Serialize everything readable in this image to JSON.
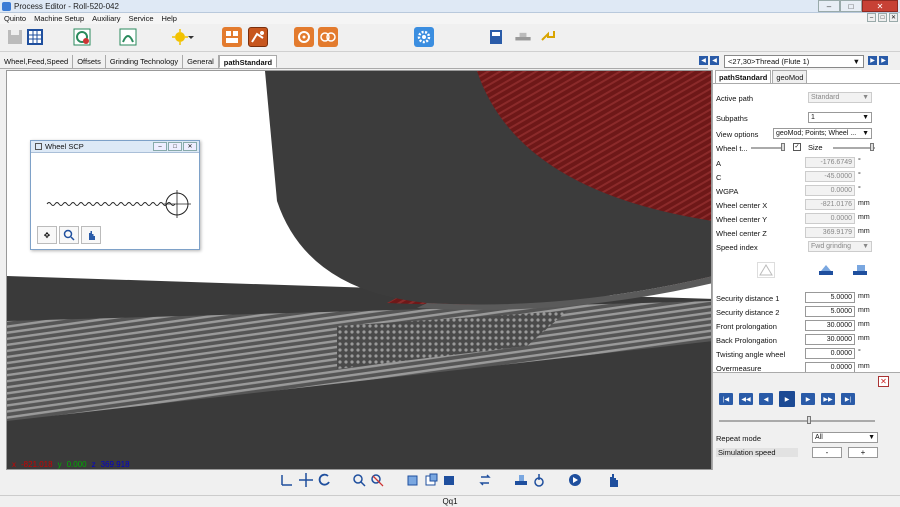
{
  "window": {
    "title": "Process Editor - Roll-520-042"
  },
  "menu": [
    "Quinto",
    "Machine Setup",
    "Auxiliary",
    "Service",
    "Help"
  ],
  "tabs": [
    {
      "label": "Wheel,Feed,Speed",
      "active": false
    },
    {
      "label": "Offsets",
      "active": false
    },
    {
      "label": "Grinding Technology",
      "active": false
    },
    {
      "label": "General",
      "active": false
    },
    {
      "label": "pathStandard",
      "active": true
    }
  ],
  "thread_select": {
    "value": "<27,30>Thread (Flute 1)"
  },
  "scp_window": {
    "title": "Wheel SCP"
  },
  "coords": {
    "x": "-821.018",
    "y": "0.000",
    "z": "369.918"
  },
  "panel": {
    "tabs": [
      {
        "label": "pathStandard",
        "active": true
      },
      {
        "label": "geoMod",
        "active": false
      }
    ],
    "active_path_label": "Active path",
    "active_path_value": "Standard",
    "subpaths_label": "Subpaths",
    "subpaths_value": "1",
    "view_options_label": "View options",
    "view_options_value": "geoMod; Points; Wheel ...",
    "wheel_t_label": "Wheel t...",
    "size_label": "Size",
    "fields": [
      {
        "label": "A",
        "value": "-176.6749",
        "unit": "°"
      },
      {
        "label": "C",
        "value": "-45.0000",
        "unit": "°"
      },
      {
        "label": "WGPA",
        "value": "0.0000",
        "unit": "°"
      },
      {
        "label": "Wheel center X",
        "value": "-821.0176",
        "unit": "mm"
      },
      {
        "label": "Wheel center Y",
        "value": "0.0000",
        "unit": "mm"
      },
      {
        "label": "Wheel center Z",
        "value": "369.9179",
        "unit": "mm"
      }
    ],
    "speed_index_label": "Speed index",
    "speed_index_value": "Fwd grinding",
    "params": [
      {
        "label": "Security distance 1",
        "value": "5.0000",
        "unit": "mm"
      },
      {
        "label": "Security distance 2",
        "value": "5.0000",
        "unit": "mm"
      },
      {
        "label": "Front prolongation",
        "value": "30.0000",
        "unit": "mm"
      },
      {
        "label": "Back Prolongation",
        "value": "30.0000",
        "unit": "mm"
      },
      {
        "label": "Twisting angle wheel",
        "value": "0.0000",
        "unit": "°"
      },
      {
        "label": "Overmeasure",
        "value": "0.0000",
        "unit": "mm"
      }
    ]
  },
  "simulation": {
    "repeat_mode_label": "Repeat mode",
    "repeat_mode_value": "All",
    "speed_label": "Simulation speed",
    "minus_label": "-",
    "plus_label": "+"
  },
  "status": {
    "text": "Qq1"
  },
  "colors": {
    "accent": "#2a5ba8",
    "wheel": "#3c3c3c",
    "red_flute": "#7a1c1c"
  }
}
